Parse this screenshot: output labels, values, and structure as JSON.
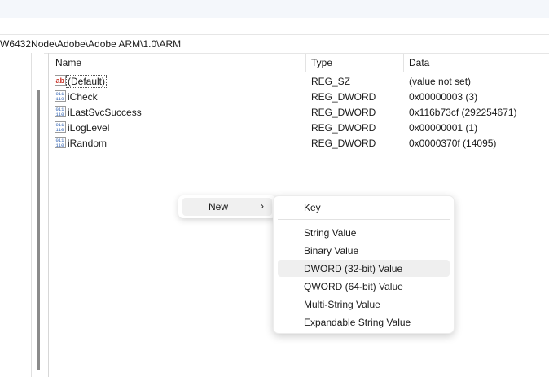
{
  "address": {
    "path": "W6432Node\\Adobe\\Adobe ARM\\1.0\\ARM"
  },
  "columns": {
    "name": "Name",
    "type": "Type",
    "data": "Data"
  },
  "rows": [
    {
      "name": "(Default)",
      "type": "REG_SZ",
      "data": "(value not set)",
      "icon": "string-value-icon"
    },
    {
      "name": "iCheck",
      "type": "REG_DWORD",
      "data": "0x00000003 (3)",
      "icon": "binary-value-icon"
    },
    {
      "name": "iLastSvcSuccess",
      "type": "REG_DWORD",
      "data": "0x116b73cf (292254671)",
      "icon": "binary-value-icon"
    },
    {
      "name": "iLogLevel",
      "type": "REG_DWORD",
      "data": "0x00000001 (1)",
      "icon": "binary-value-icon"
    },
    {
      "name": "iRandom",
      "type": "REG_DWORD",
      "data": "0x0000370f (14095)",
      "icon": "binary-value-icon"
    }
  ],
  "context_menu": {
    "new_label": "New",
    "arrow": "›",
    "submenu": [
      {
        "label": "Key"
      },
      {
        "label": "String Value"
      },
      {
        "label": "Binary Value"
      },
      {
        "label": "DWORD (32-bit) Value",
        "highlighted": true
      },
      {
        "label": "QWORD (64-bit) Value"
      },
      {
        "label": "Multi-String Value"
      },
      {
        "label": "Expandable String Value"
      }
    ]
  },
  "colors": {
    "string_icon_red": "#c8352b",
    "binary_icon_blue": "#2a5db0",
    "menu_highlight": "#efefef"
  }
}
